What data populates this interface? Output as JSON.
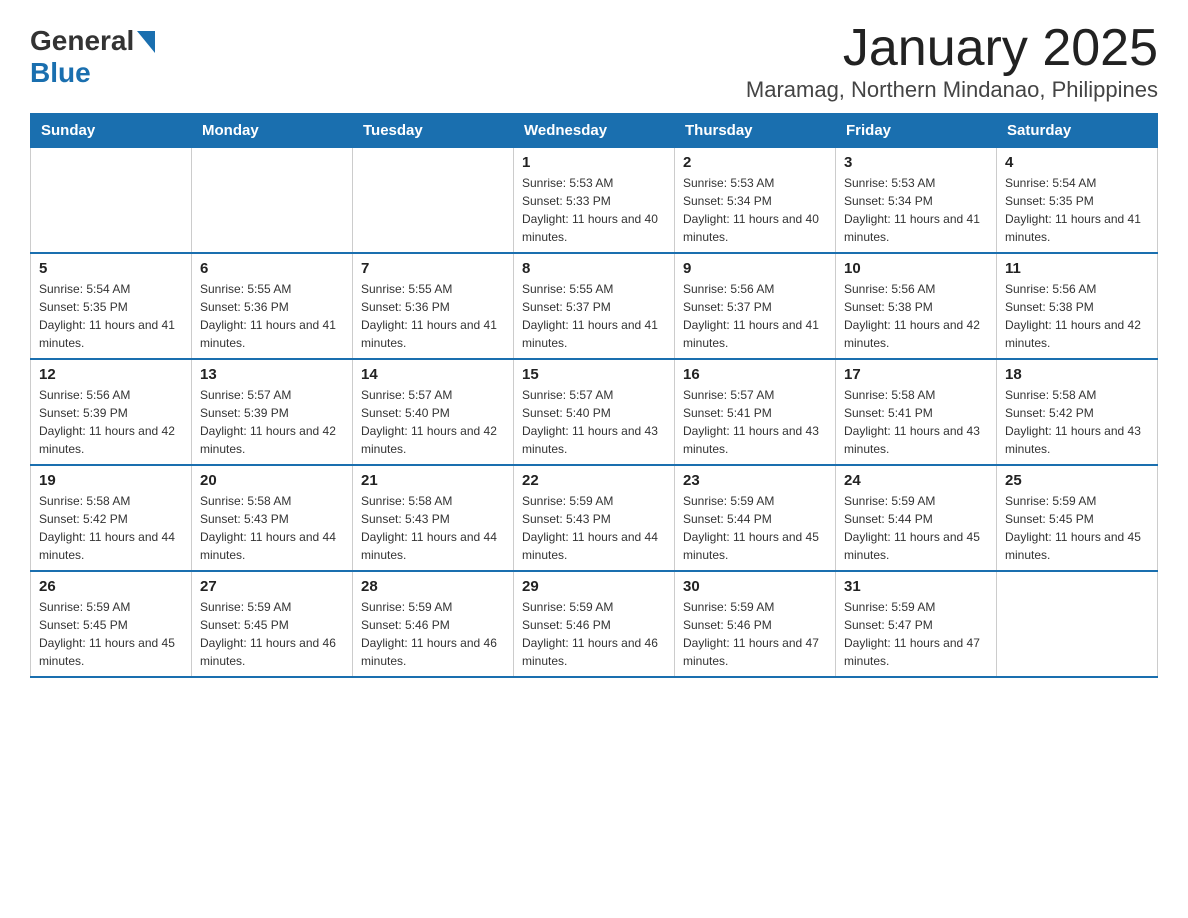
{
  "logo": {
    "general": "General",
    "blue": "Blue"
  },
  "title": "January 2025",
  "subtitle": "Maramag, Northern Mindanao, Philippines",
  "weekdays": [
    "Sunday",
    "Monday",
    "Tuesday",
    "Wednesday",
    "Thursday",
    "Friday",
    "Saturday"
  ],
  "weeks": [
    [
      {
        "day": "",
        "sunrise": "",
        "sunset": "",
        "daylight": ""
      },
      {
        "day": "",
        "sunrise": "",
        "sunset": "",
        "daylight": ""
      },
      {
        "day": "",
        "sunrise": "",
        "sunset": "",
        "daylight": ""
      },
      {
        "day": "1",
        "sunrise": "Sunrise: 5:53 AM",
        "sunset": "Sunset: 5:33 PM",
        "daylight": "Daylight: 11 hours and 40 minutes."
      },
      {
        "day": "2",
        "sunrise": "Sunrise: 5:53 AM",
        "sunset": "Sunset: 5:34 PM",
        "daylight": "Daylight: 11 hours and 40 minutes."
      },
      {
        "day": "3",
        "sunrise": "Sunrise: 5:53 AM",
        "sunset": "Sunset: 5:34 PM",
        "daylight": "Daylight: 11 hours and 41 minutes."
      },
      {
        "day": "4",
        "sunrise": "Sunrise: 5:54 AM",
        "sunset": "Sunset: 5:35 PM",
        "daylight": "Daylight: 11 hours and 41 minutes."
      }
    ],
    [
      {
        "day": "5",
        "sunrise": "Sunrise: 5:54 AM",
        "sunset": "Sunset: 5:35 PM",
        "daylight": "Daylight: 11 hours and 41 minutes."
      },
      {
        "day": "6",
        "sunrise": "Sunrise: 5:55 AM",
        "sunset": "Sunset: 5:36 PM",
        "daylight": "Daylight: 11 hours and 41 minutes."
      },
      {
        "day": "7",
        "sunrise": "Sunrise: 5:55 AM",
        "sunset": "Sunset: 5:36 PM",
        "daylight": "Daylight: 11 hours and 41 minutes."
      },
      {
        "day": "8",
        "sunrise": "Sunrise: 5:55 AM",
        "sunset": "Sunset: 5:37 PM",
        "daylight": "Daylight: 11 hours and 41 minutes."
      },
      {
        "day": "9",
        "sunrise": "Sunrise: 5:56 AM",
        "sunset": "Sunset: 5:37 PM",
        "daylight": "Daylight: 11 hours and 41 minutes."
      },
      {
        "day": "10",
        "sunrise": "Sunrise: 5:56 AM",
        "sunset": "Sunset: 5:38 PM",
        "daylight": "Daylight: 11 hours and 42 minutes."
      },
      {
        "day": "11",
        "sunrise": "Sunrise: 5:56 AM",
        "sunset": "Sunset: 5:38 PM",
        "daylight": "Daylight: 11 hours and 42 minutes."
      }
    ],
    [
      {
        "day": "12",
        "sunrise": "Sunrise: 5:56 AM",
        "sunset": "Sunset: 5:39 PM",
        "daylight": "Daylight: 11 hours and 42 minutes."
      },
      {
        "day": "13",
        "sunrise": "Sunrise: 5:57 AM",
        "sunset": "Sunset: 5:39 PM",
        "daylight": "Daylight: 11 hours and 42 minutes."
      },
      {
        "day": "14",
        "sunrise": "Sunrise: 5:57 AM",
        "sunset": "Sunset: 5:40 PM",
        "daylight": "Daylight: 11 hours and 42 minutes."
      },
      {
        "day": "15",
        "sunrise": "Sunrise: 5:57 AM",
        "sunset": "Sunset: 5:40 PM",
        "daylight": "Daylight: 11 hours and 43 minutes."
      },
      {
        "day": "16",
        "sunrise": "Sunrise: 5:57 AM",
        "sunset": "Sunset: 5:41 PM",
        "daylight": "Daylight: 11 hours and 43 minutes."
      },
      {
        "day": "17",
        "sunrise": "Sunrise: 5:58 AM",
        "sunset": "Sunset: 5:41 PM",
        "daylight": "Daylight: 11 hours and 43 minutes."
      },
      {
        "day": "18",
        "sunrise": "Sunrise: 5:58 AM",
        "sunset": "Sunset: 5:42 PM",
        "daylight": "Daylight: 11 hours and 43 minutes."
      }
    ],
    [
      {
        "day": "19",
        "sunrise": "Sunrise: 5:58 AM",
        "sunset": "Sunset: 5:42 PM",
        "daylight": "Daylight: 11 hours and 44 minutes."
      },
      {
        "day": "20",
        "sunrise": "Sunrise: 5:58 AM",
        "sunset": "Sunset: 5:43 PM",
        "daylight": "Daylight: 11 hours and 44 minutes."
      },
      {
        "day": "21",
        "sunrise": "Sunrise: 5:58 AM",
        "sunset": "Sunset: 5:43 PM",
        "daylight": "Daylight: 11 hours and 44 minutes."
      },
      {
        "day": "22",
        "sunrise": "Sunrise: 5:59 AM",
        "sunset": "Sunset: 5:43 PM",
        "daylight": "Daylight: 11 hours and 44 minutes."
      },
      {
        "day": "23",
        "sunrise": "Sunrise: 5:59 AM",
        "sunset": "Sunset: 5:44 PM",
        "daylight": "Daylight: 11 hours and 45 minutes."
      },
      {
        "day": "24",
        "sunrise": "Sunrise: 5:59 AM",
        "sunset": "Sunset: 5:44 PM",
        "daylight": "Daylight: 11 hours and 45 minutes."
      },
      {
        "day": "25",
        "sunrise": "Sunrise: 5:59 AM",
        "sunset": "Sunset: 5:45 PM",
        "daylight": "Daylight: 11 hours and 45 minutes."
      }
    ],
    [
      {
        "day": "26",
        "sunrise": "Sunrise: 5:59 AM",
        "sunset": "Sunset: 5:45 PM",
        "daylight": "Daylight: 11 hours and 45 minutes."
      },
      {
        "day": "27",
        "sunrise": "Sunrise: 5:59 AM",
        "sunset": "Sunset: 5:45 PM",
        "daylight": "Daylight: 11 hours and 46 minutes."
      },
      {
        "day": "28",
        "sunrise": "Sunrise: 5:59 AM",
        "sunset": "Sunset: 5:46 PM",
        "daylight": "Daylight: 11 hours and 46 minutes."
      },
      {
        "day": "29",
        "sunrise": "Sunrise: 5:59 AM",
        "sunset": "Sunset: 5:46 PM",
        "daylight": "Daylight: 11 hours and 46 minutes."
      },
      {
        "day": "30",
        "sunrise": "Sunrise: 5:59 AM",
        "sunset": "Sunset: 5:46 PM",
        "daylight": "Daylight: 11 hours and 47 minutes."
      },
      {
        "day": "31",
        "sunrise": "Sunrise: 5:59 AM",
        "sunset": "Sunset: 5:47 PM",
        "daylight": "Daylight: 11 hours and 47 minutes."
      },
      {
        "day": "",
        "sunrise": "",
        "sunset": "",
        "daylight": ""
      }
    ]
  ]
}
